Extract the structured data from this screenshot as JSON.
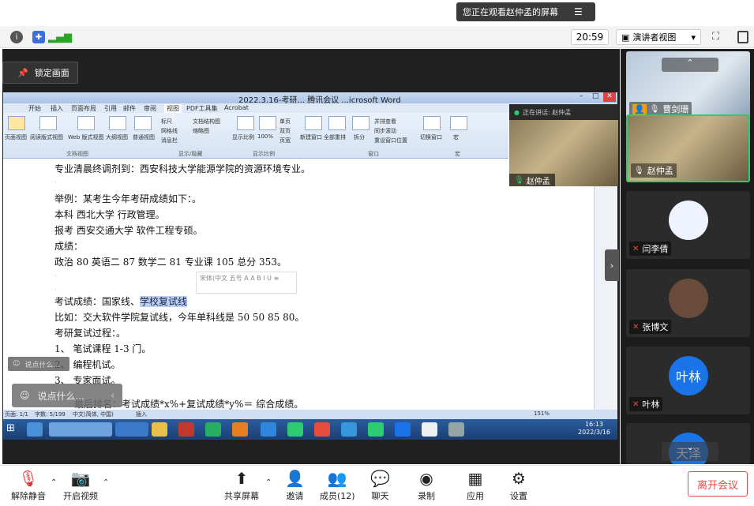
{
  "banner": {
    "text": "您正在观看赵仲孟的屏幕",
    "menu_icon": "menu-icon"
  },
  "toolbar": {
    "time": "20:59",
    "view_label": "演讲者视图",
    "view_caret": "▾"
  },
  "stage": {
    "lock_label": "锁定画面",
    "expand_label": "›"
  },
  "word": {
    "title": "2022.3.16-考研... 腾讯会议 ...icrosoft Word",
    "tabs": [
      "开始",
      "插入",
      "页面布局",
      "引用",
      "邮件",
      "审阅",
      "视图",
      "PDF工具集",
      "Acrobat"
    ],
    "ribbon": {
      "buttons": [
        "页面视图",
        "阅读版式视图",
        "Web 版式视图",
        "大纲视图",
        "普通视图"
      ],
      "checks": [
        "标尺",
        "网格线",
        "消息栏",
        "文档结构图",
        "缩略图"
      ],
      "zoom": [
        "显示比例",
        "100%",
        "单页",
        "双页",
        "页宽"
      ],
      "window": [
        "新建窗口",
        "全部重排",
        "拆分",
        "并排查看",
        "同步滚动",
        "重设窗口位置",
        "切换窗口",
        "宏"
      ],
      "groups": [
        "文档视图",
        "显示/隐藏",
        "显示比例",
        "窗口",
        "宏"
      ]
    },
    "lines": [
      "专业清晨终调剂到：西安科技大学能源学院的资源环境专业。",
      "举例：某考生今年考研成绩如下：。",
      "本科  西北大学  行政管理。",
      "报考  西安交通大学  软件工程专硕。",
      "成绩：",
      "政治 80  英语二 87  数学二 81  专业课 105  总分 353。",
      "考试成绩：国家线、",
      "学校复试线",
      "比如：交大软件学院复试线，今年单科线是 50    50    85    80。",
      "考研复试过程：。",
      "1、  笔试课程 1-3 门。",
      "2、  编程机试。",
      "3、  专家面试。",
      "最后排名：考试成绩*x%+复试成绩*y%＝ 综合成绩。"
    ],
    "mini_toolbar": "宋体(中文  五号  A  A  B  I  U  ≡",
    "status": [
      "页面: 1/1",
      "字数: 5/199",
      "中文(简体, 中国)",
      "插入",
      "151%"
    ],
    "taskbar_clock": [
      "16:13",
      "2022/3/16"
    ]
  },
  "speaker": {
    "header": "正在讲话: 赵仲孟",
    "name": "赵仲孟"
  },
  "chat": {
    "mini": "说点什么...",
    "box": "说点什么...",
    "collapse": "‹"
  },
  "participants": [
    {
      "name": "曹剑珊",
      "avatar_text": "",
      "muted": false,
      "has_video": true,
      "video_color": "#c9d6e2"
    },
    {
      "name": "赵仲孟",
      "avatar_text": "",
      "muted": false,
      "has_video": true,
      "video_color": "#8a7a5a"
    },
    {
      "name": "闫李倩",
      "avatar_text": "",
      "muted": true,
      "has_video": false,
      "avatar_color": "#eef3ff"
    },
    {
      "name": "张博文",
      "avatar_text": "",
      "muted": true,
      "has_video": false,
      "avatar_color": "#6a4a3a"
    },
    {
      "name": "叶林",
      "avatar_text": "叶林",
      "muted": true,
      "has_video": false,
      "avatar_color": "#1a73e8"
    },
    {
      "name": "",
      "avatar_text": "天泽",
      "muted": true,
      "has_video": false,
      "avatar_color": "#1a73e8"
    }
  ],
  "controls": {
    "mute": "解除静音",
    "video": "开启视频",
    "share": "共享屏幕",
    "invite": "邀请",
    "members": "成员(12)",
    "chat": "聊天",
    "record": "录制",
    "apps": "应用",
    "settings": "设置",
    "leave": "离开会议"
  },
  "colors": {
    "accent": "#1a73e8",
    "danger": "#e44444",
    "active_border": "#2ecc71"
  }
}
